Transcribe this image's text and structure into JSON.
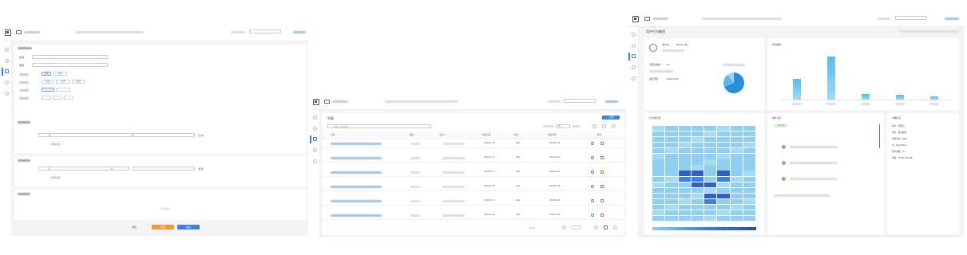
{
  "panel1": {
    "buttons": {
      "reset_label": "重置",
      "save_label": "保存",
      "submit_label": "提交"
    },
    "empty_state_text": "暂无数据",
    "section_fields": [
      "基础信息",
      "名称",
      "类型",
      "备注"
    ],
    "toggle_options": [
      "选项",
      "选项"
    ],
    "triple_options": [
      "选项",
      "选项",
      "选项"
    ],
    "add_link": "+ 添加条件",
    "add_link_2": "+ 添加条件",
    "unit_1": "元/次",
    "unit_2": "次/天"
  },
  "panel2": {
    "title": "列表",
    "primary_button": "+ 新增",
    "search_placeholder": "请输入搜索内容",
    "page_size": "10",
    "columns": [
      "名称",
      "创建人",
      "负责人",
      "创建时间",
      "状态",
      "更新时间",
      "操作"
    ],
    "rows": [
      {
        "status": "false",
        "created": "2019-01-13",
        "updated": "2024-01-13"
      },
      {
        "status": "false",
        "created": "2019-01-17",
        "updated": "2024-01-17"
      },
      {
        "status": "false",
        "created": "2019-01-17",
        "updated": "2024-01-17"
      },
      {
        "status": "false",
        "created": "2019-01-18",
        "updated": "2024-01-18"
      },
      {
        "status": "false",
        "created": "2019-01-20",
        "updated": "2024-01-20"
      },
      {
        "status": "false",
        "created": "2019-01-22",
        "updated": "2024-01-22"
      }
    ],
    "pagination": "共 6 条"
  },
  "panel3": {
    "title": "用户行为概览",
    "account_label": "用户ID：",
    "account_id": "admin_001",
    "stats": [
      {
        "label": "活跃设备数",
        "value": "PC"
      },
      {
        "label": "最近登录",
        "value": "2024-04-03"
      }
    ],
    "bar_chart_title": "访问趋势",
    "chart_data": {
      "type": "bar",
      "categories": [
        "",
        "",
        "",
        "",
        ""
      ],
      "values": [
        36,
        75,
        10,
        8,
        6
      ],
      "ylim": [
        0,
        80
      ]
    },
    "heatmap_title": "行为热力图",
    "timeline_title": "事件记录",
    "timeline_badge": "查看全部",
    "details_title": "详细信息",
    "details": [
      "用户：管理员",
      "角色：所有权限",
      "创建时间：2024",
      "IP：192.168.1.1",
      "登录次数：12",
      "设备：10.100.100.100"
    ],
    "colors": {
      "accent": "#3d7fe3",
      "bar": "#56bde9",
      "pie_dark": "#2a8fd8",
      "pie_light": "#9fd8f5"
    }
  }
}
